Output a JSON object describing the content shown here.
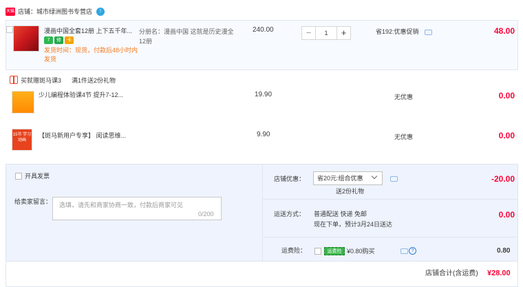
{
  "shop": {
    "logo_text": "天猫",
    "label": "店铺：城市绿洲图书专营店",
    "chat_icon_text": "!"
  },
  "main_item": {
    "title": "漫画中国全套12册 上下五千年...",
    "badges": [
      "7",
      "修",
      "卡"
    ],
    "shipping_note": "发货时间：现货，付款后48小时内发货",
    "sku_label": "分册名：漫画中国 这就是历史漫全12册",
    "price": "240.00",
    "quantity": "1",
    "minus": "−",
    "plus": "+",
    "promo": "省192:优惠促销",
    "amount": "48.00"
  },
  "gift": {
    "title": "买就赠斑马课3",
    "rule": "满1件送2份礼物",
    "items": [
      {
        "name": "少儿编程体验课4节 提升7-12...",
        "price": "19.90",
        "promo": "无优惠",
        "amount": "0.00"
      },
      {
        "name": "【斑马新用户专享】 阅读思维...",
        "price": "9.90",
        "promo": "无优惠",
        "amount": "0.00",
        "thumb_text": "15节 学习 动画"
      }
    ]
  },
  "order": {
    "invoice_label": "开具发票",
    "memo_label": "给卖家留言：",
    "memo_placeholder": "选填，请先和商家协商一致，付款后商家可见",
    "memo_count": "0/200",
    "shop_discount_label": "店铺优惠：",
    "shop_discount_value": "省20元:组合优惠",
    "shop_discount_sub": "送2份礼物",
    "shop_discount_amount": "-20.00",
    "delivery_label": "运送方式：",
    "delivery_method": "普通配送 快递 免邮",
    "delivery_eta": "现在下单，预计3月24日送达",
    "delivery_amount": "0.00",
    "insurance_label": "运费险：",
    "insurance_badge": "运费险",
    "insurance_text": "¥0.80购买",
    "insurance_help": "?",
    "insurance_amount": "0.80",
    "total_label": "店铺合计(含运费)",
    "total_amount": "¥28.00"
  },
  "colors": {
    "accent_red": "#ff0036",
    "orange_note": "#f47a1f",
    "footer_bg": "#eef3fd"
  }
}
